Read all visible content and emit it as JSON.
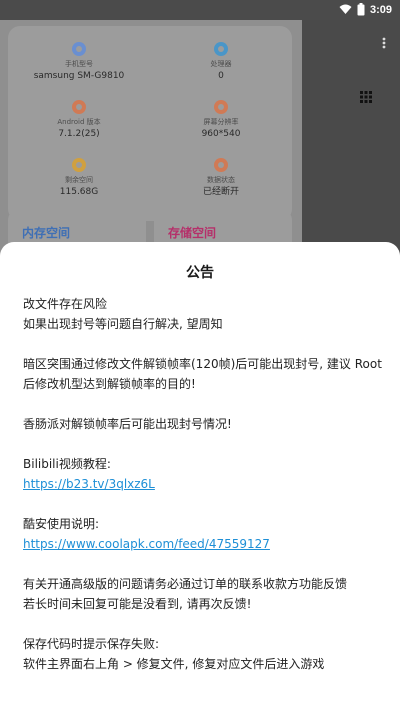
{
  "status_bar": {
    "time": "3:09",
    "icons": [
      "wifi-icon",
      "battery-icon"
    ]
  },
  "background": {
    "device_info": [
      {
        "label": "手机型号",
        "value": "samsung SM-G9810",
        "icon": "phone-icon",
        "color": "#6a8fd0"
      },
      {
        "label": "处理器",
        "value": "0",
        "icon": "cpu-icon",
        "color": "#4a96c8"
      },
      {
        "label": "Android 版本",
        "value": "7.1.2(25)",
        "icon": "android-icon",
        "color": "#d07a55"
      },
      {
        "label": "屏幕分辨率",
        "value": "960*540",
        "icon": "screen-icon",
        "color": "#d07a55"
      },
      {
        "label": "剩余空间",
        "value": "115.68G",
        "icon": "storage-icon",
        "color": "#d0a040"
      },
      {
        "label": "数据状态",
        "value": "已经断开",
        "icon": "data-icon",
        "color": "#d07a55"
      }
    ],
    "cards": [
      {
        "title": "内存空间",
        "color": "#3f6fb5"
      },
      {
        "title": "存储空间",
        "color": "#b5306a"
      }
    ],
    "icons": [
      "overflow-menu-icon",
      "grid-icon"
    ]
  },
  "sheet": {
    "title": "公告",
    "lines": {
      "l1": "改文件存在风险",
      "l2": "如果出现封号等问题自行解决, 望周知",
      "l3": "暗区突围通过修改文件解锁帧率(120帧)后可能出现封号, 建议 Root 后修改机型达到解锁帧率的目的!",
      "l4": "香肠派对解锁帧率后可能出现封号情况!",
      "l5": "Bilibili视频教程:",
      "l6": "https://b23.tv/3qlxz6L",
      "l7": "酷安使用说明:",
      "l8": "https://www.coolapk.com/feed/47559127",
      "l9": "有关开通高级版的问题请务必通过订单的联系收款方功能反馈",
      "l10": "若长时间未回复可能是没看到, 请再次反馈!",
      "l11": "保存代码时提示保存失败:",
      "l12": "软件主界面右上角 > 修复文件, 修复对应文件后进入游戏"
    }
  },
  "colors": {
    "link": "#1e8fd6",
    "sheet_bg": "#ffffff",
    "scrim": "#5e5e5e"
  }
}
